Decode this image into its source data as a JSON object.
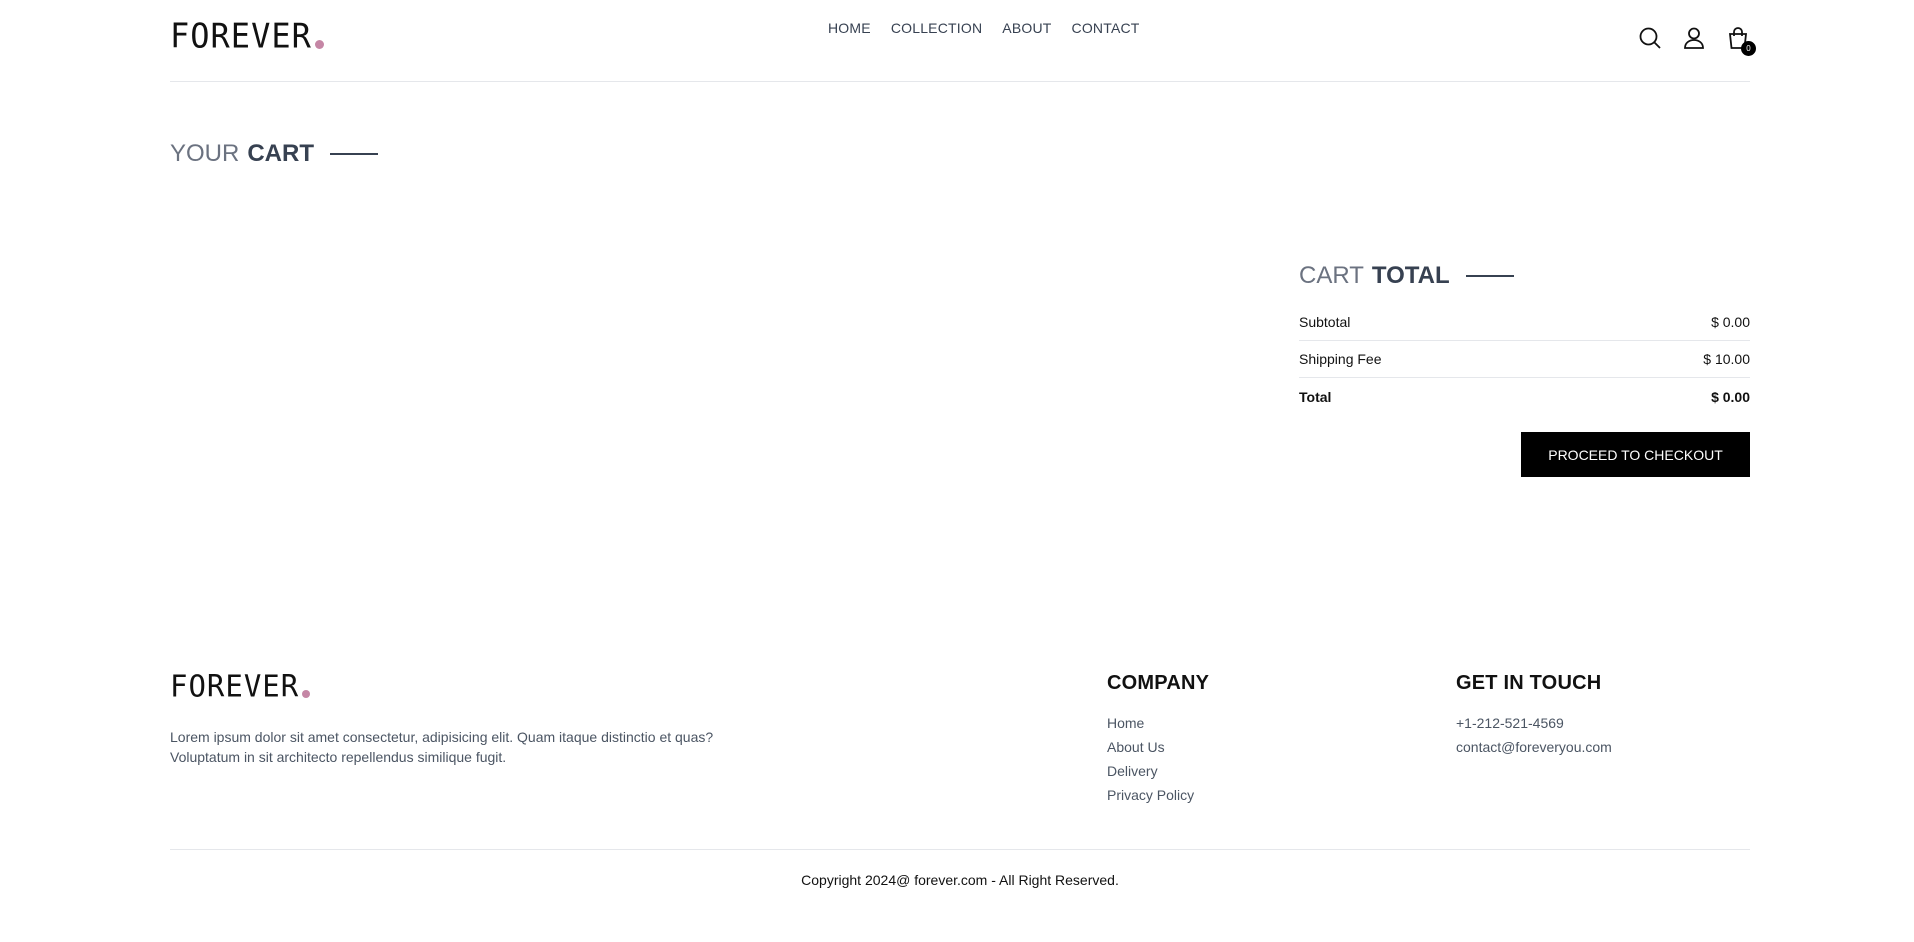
{
  "header": {
    "logo_text": "FOREVER",
    "nav": [
      "HOME",
      "COLLECTION",
      "ABOUT",
      "CONTACT"
    ],
    "cart_count": "0",
    "icons": [
      "search-icon",
      "profile-icon",
      "cart-icon"
    ]
  },
  "cart": {
    "title_light": "YOUR",
    "title_bold": "CART"
  },
  "cart_total": {
    "title_light": "CART",
    "title_bold": "TOTAL",
    "subtotal_label": "Subtotal",
    "subtotal_value": "$ 0.00",
    "shipping_label": "Shipping Fee",
    "shipping_value": "$ 10.00",
    "total_label": "Total",
    "total_value": "$ 0.00",
    "checkout_label": "PROCEED TO CHECKOUT"
  },
  "footer": {
    "logo_text": "FOREVER",
    "description_line1": "Lorem ipsum dolor sit amet consectetur, adipisicing elit. Quam itaque distinctio et quas?",
    "description_line2": "Voluptatum in sit architecto repellendus similique fugit.",
    "company_title": "COMPANY",
    "company_links": [
      "Home",
      "About Us",
      "Delivery",
      "Privacy Policy"
    ],
    "contact_title": "GET IN TOUCH",
    "phone": "+1-212-521-4569",
    "email": "contact@foreveryou.com",
    "copyright": "Copyright 2024@ forever.com - All Right Reserved."
  },
  "colors": {
    "accent_dot": "#c586a5",
    "button_bg": "#000000",
    "text_primary": "#374151"
  }
}
